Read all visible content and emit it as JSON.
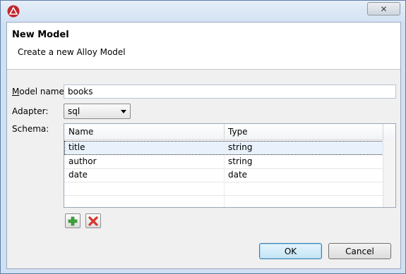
{
  "window": {
    "close_glyph": "✕"
  },
  "header": {
    "title": "New Model",
    "subtitle": "Create a new Alloy Model"
  },
  "form": {
    "model_name_label_underlined": "M",
    "model_name_label_rest": "odel name:",
    "model_name_value": "books",
    "adapter_label": "Adapter:",
    "adapter_value": "sql",
    "schema_label": "Schema:"
  },
  "schema_table": {
    "columns": [
      "Name",
      "Type"
    ],
    "rows": [
      {
        "name": "title",
        "type": "string",
        "selected": true
      },
      {
        "name": "author",
        "type": "string"
      },
      {
        "name": "date",
        "type": "date"
      }
    ]
  },
  "buttons": {
    "ok": "OK",
    "cancel": "Cancel"
  },
  "icons": {
    "app": "alloy-triangle-icon",
    "add": "plus-icon",
    "remove": "delete-x-icon"
  },
  "colors": {
    "accent": "#3c7fb1",
    "add_green": "#3fa83a",
    "remove_red": "#d9342b",
    "app_icon_red": "#c1272d"
  }
}
